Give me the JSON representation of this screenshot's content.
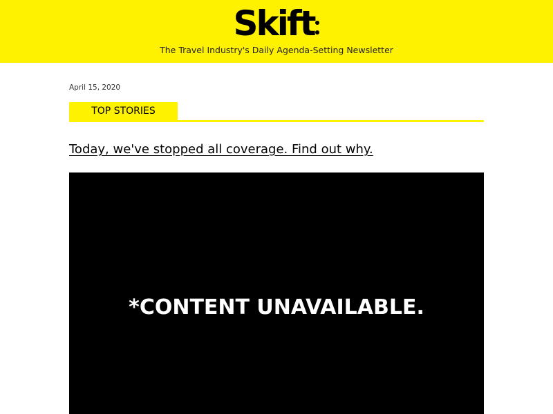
{
  "header": {
    "logo_text": "Skift",
    "tagline": "The Travel Industry's Daily Agenda-Setting Newsletter",
    "background_color": "#fff200"
  },
  "newsletter": {
    "date": "April 15, 2020",
    "section_label": "TOP STORIES",
    "headline": "Today, we've stopped all coverage. Find out why.",
    "media_text": "*CONTENT UNAVAILABLE."
  }
}
